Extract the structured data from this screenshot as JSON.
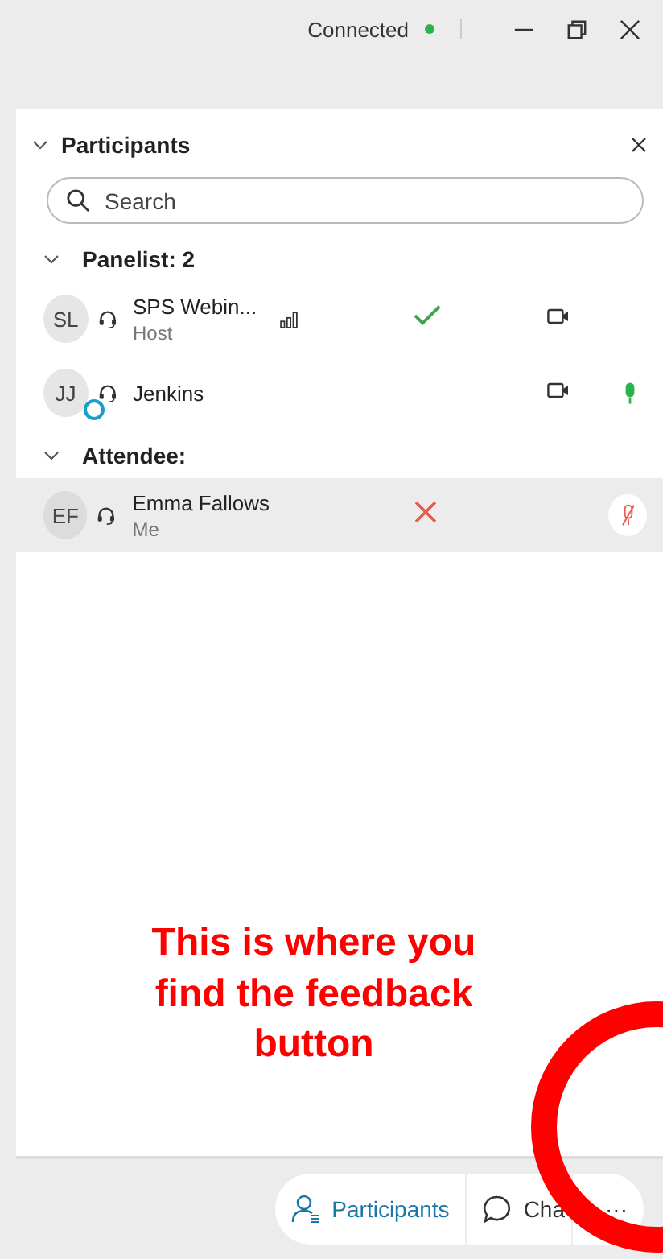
{
  "title_bar": {
    "status": "Connected",
    "connected": true
  },
  "panel": {
    "title": "Participants",
    "expanded": true,
    "search": {
      "placeholder": "Search"
    },
    "sections": [
      {
        "label": "Panelist: 2",
        "expanded": true,
        "participants": [
          {
            "initials": "SL",
            "name": "SPS Webin...",
            "role": "Host",
            "selected": false,
            "signal": true,
            "video": true,
            "feedback": {
              "kind": "check"
            }
          },
          {
            "initials": "JJ",
            "name": "Jenkins",
            "selected": false,
            "app_badge": true,
            "video": true,
            "mic": {
              "kind": "on"
            }
          }
        ]
      },
      {
        "label": "Attendee:",
        "expanded": true,
        "participants": [
          {
            "initials": "EF",
            "name": "Emma Fallows",
            "role": "Me",
            "selected": true,
            "feedback": {
              "kind": "cross"
            },
            "mic": {
              "kind": "muted"
            }
          }
        ]
      }
    ]
  },
  "annotation": {
    "text": "This is where you find the feedback button"
  },
  "bottom_bar": [
    {
      "label": "Participants",
      "kind": "people",
      "selected": true
    },
    {
      "label": "Cha",
      "kind": "chat",
      "selected": false
    },
    {
      "label": "···",
      "kind": "more",
      "selected": false
    }
  ]
}
